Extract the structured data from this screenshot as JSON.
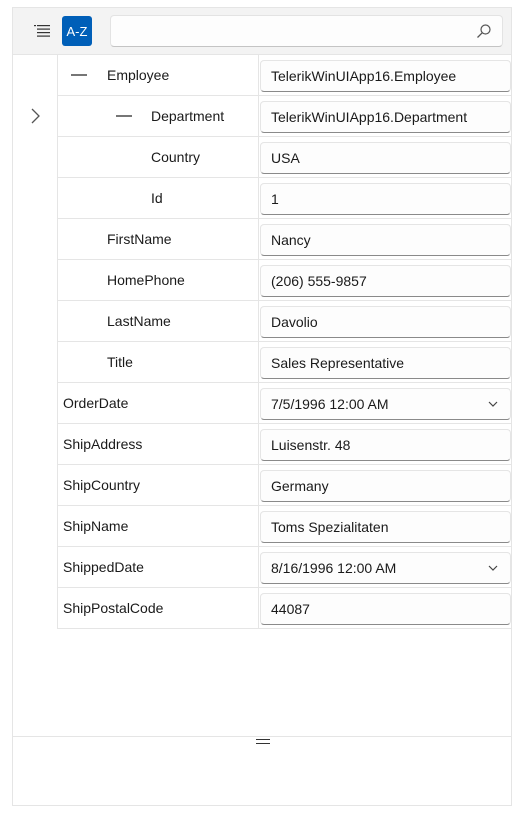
{
  "toolbar": {
    "az_label": "A-Z",
    "search": {
      "value": "",
      "placeholder": ""
    }
  },
  "properties": [
    {
      "name": "Employee",
      "value": "TelerikWinUIApp16.Employee",
      "indent": 1,
      "collapsible": true
    },
    {
      "name": "Department",
      "value": "TelerikWinUIApp16.Department",
      "indent": 2,
      "collapsible": true
    },
    {
      "name": "Country",
      "value": "USA",
      "indent": 2
    },
    {
      "name": "Id",
      "value": "1",
      "indent": 2
    },
    {
      "name": "FirstName",
      "value": "Nancy",
      "indent": 1
    },
    {
      "name": "HomePhone",
      "value": "(206) 555-9857",
      "indent": 1
    },
    {
      "name": "LastName",
      "value": "Davolio",
      "indent": 1
    },
    {
      "name": "Title",
      "value": "Sales Representative",
      "indent": 1
    },
    {
      "name": "OrderDate",
      "value": "7/5/1996 12:00 AM",
      "indent": 0,
      "dropdown": true
    },
    {
      "name": "ShipAddress",
      "value": "Luisenstr. 48",
      "indent": 0
    },
    {
      "name": "ShipCountry",
      "value": "Germany",
      "indent": 0
    },
    {
      "name": "ShipName",
      "value": "Toms Spezialitaten",
      "indent": 0
    },
    {
      "name": "ShippedDate",
      "value": "8/16/1996 12:00 AM",
      "indent": 0,
      "dropdown": true
    },
    {
      "name": "ShipPostalCode",
      "value": "44087",
      "indent": 0
    }
  ]
}
